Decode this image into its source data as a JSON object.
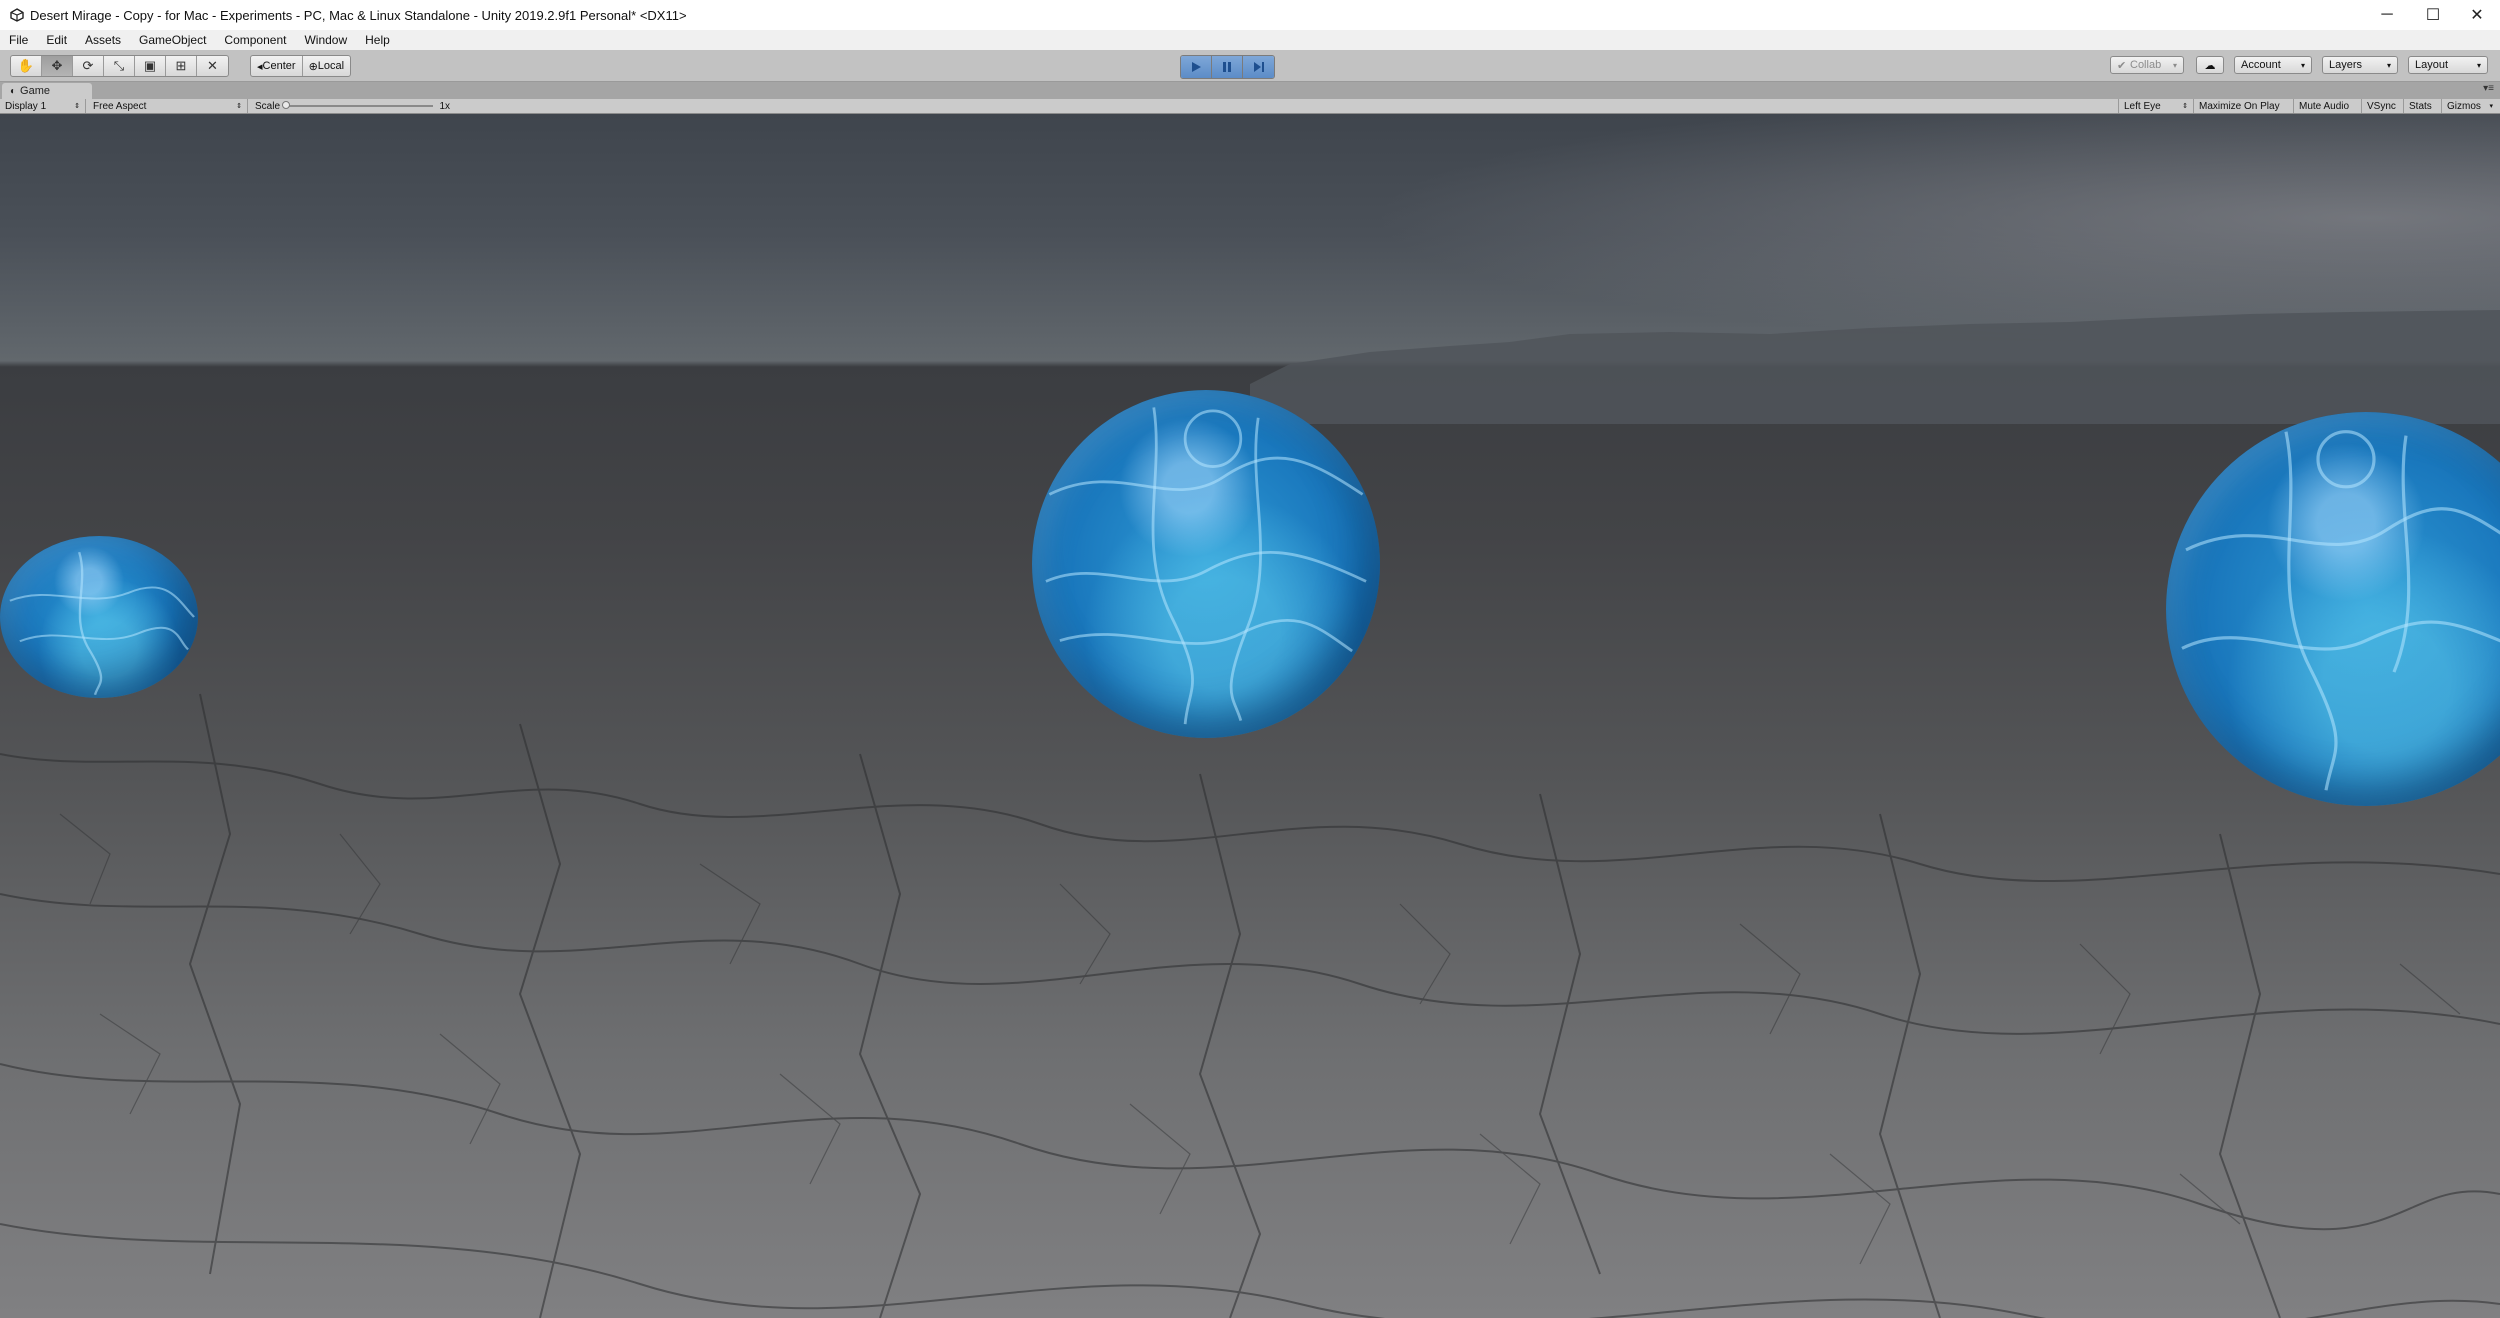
{
  "window": {
    "title": "Desert Mirage - Copy - for Mac - Experiments - PC, Mac & Linux Standalone - Unity 2019.2.9f1 Personal* <DX11>",
    "controls": {
      "minimize": "─",
      "maximize": "☐",
      "close": "✕"
    }
  },
  "menu": {
    "items": [
      "File",
      "Edit",
      "Assets",
      "GameObject",
      "Component",
      "Window",
      "Help"
    ]
  },
  "toolbar": {
    "tools": [
      {
        "name": "hand-tool-icon",
        "glyph": "✋"
      },
      {
        "name": "move-tool-icon",
        "glyph": "✥"
      },
      {
        "name": "rotate-tool-icon",
        "glyph": "⟳"
      },
      {
        "name": "scale-tool-icon",
        "glyph": "⤡"
      },
      {
        "name": "rect-tool-icon",
        "glyph": "▣"
      },
      {
        "name": "transform-tool-icon",
        "glyph": "⊞"
      },
      {
        "name": "custom-tool-icon",
        "glyph": "✕"
      }
    ],
    "pivot_label": "Center",
    "pivot_glyph": "◂",
    "space_label": "Local",
    "space_glyph": "⊕",
    "play": {
      "play_glyph": "▶",
      "pause_glyph": "❚❚",
      "step_glyph": "▶|"
    },
    "collab_label": "Collab",
    "collab_glyph": "✔",
    "cloud_glyph": "☁",
    "account_label": "Account",
    "layers_label": "Layers",
    "layout_label": "Layout",
    "caret": "▾"
  },
  "game_tab": {
    "label": "Game",
    "icon_glyph": "◐",
    "menu_glyph": "▾≡"
  },
  "game_bar": {
    "display": "Display 1",
    "aspect": "Free Aspect",
    "scale_label": "Scale",
    "scale_value": "1x",
    "scale_level": 0,
    "eye": "Left Eye",
    "maximize": "Maximize On Play",
    "mute": "Mute Audio",
    "vsync": "VSync",
    "stats": "Stats",
    "gizmos": "Gizmos",
    "updown": "⇕"
  },
  "colors": {
    "play_active": "#5c8cc7",
    "sphere": "#1a78bd",
    "editor_bg": "#c2c2c2"
  }
}
